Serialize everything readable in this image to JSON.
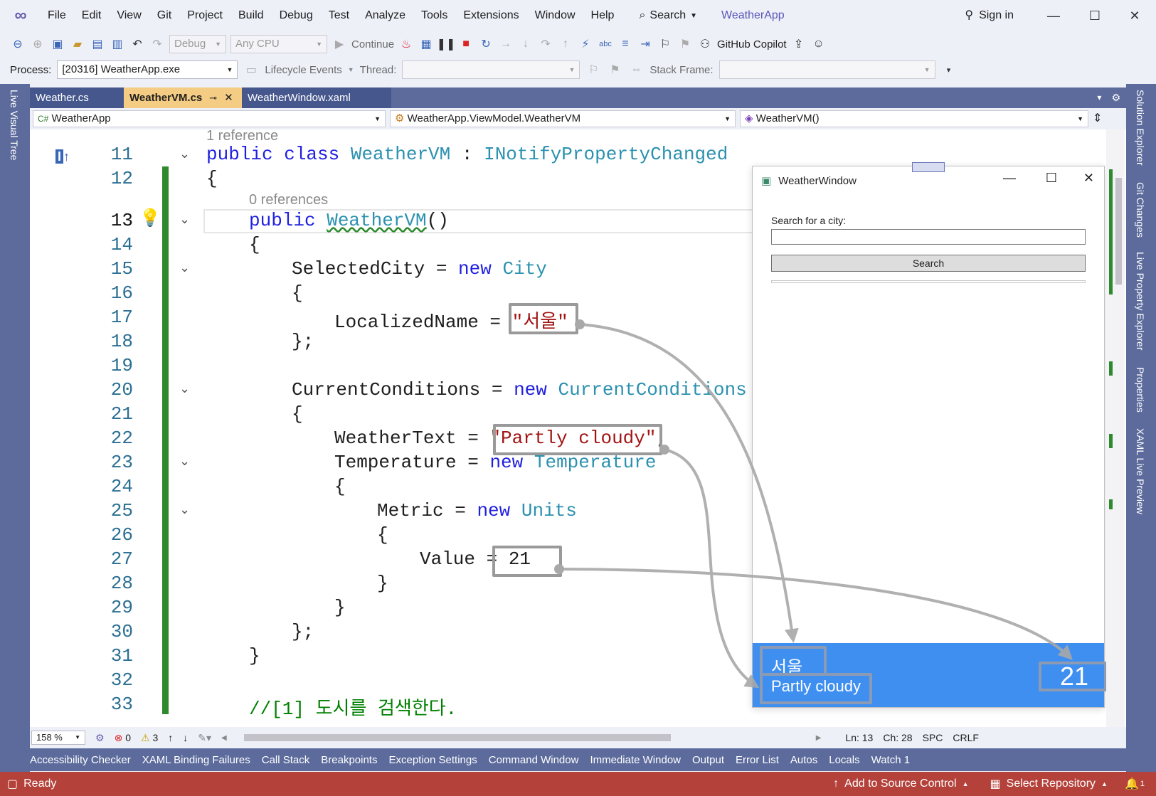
{
  "menubar": {
    "items": [
      "File",
      "Edit",
      "View",
      "Git",
      "Project",
      "Build",
      "Debug",
      "Test",
      "Analyze",
      "Tools",
      "Extensions",
      "Window",
      "Help"
    ],
    "search_label": "Search",
    "app_name": "WeatherApp",
    "sign_in": "Sign in"
  },
  "toolbar1": {
    "config": "Debug",
    "platform": "Any CPU",
    "continue_label": "Continue",
    "copilot_label": "GitHub Copilot"
  },
  "toolbar2": {
    "process_label": "Process:",
    "process_value": "[20316] WeatherApp.exe",
    "lifecycle_label": "Lifecycle Events",
    "thread_label": "Thread:",
    "stackframe_label": "Stack Frame:"
  },
  "side_tabs": {
    "left": "Live Visual Tree",
    "right": [
      "Solution Explorer",
      "Git Changes",
      "Live Property Explorer",
      "Properties",
      "XAML Live Preview"
    ]
  },
  "doc_tabs": [
    {
      "label": "Weather.cs",
      "active": false
    },
    {
      "label": "WeatherVM.cs",
      "active": true
    },
    {
      "label": "WeatherWindow.xaml",
      "active": false
    }
  ],
  "navbar": {
    "project": "WeatherApp",
    "type": "WeatherApp.ViewModel.WeatherVM",
    "member": "WeatherVM()"
  },
  "editor": {
    "ref_hint_class": "1 reference",
    "ref_hint_ctor": "0 references",
    "line_numbers": [
      "11",
      "12",
      "13",
      "14",
      "15",
      "16",
      "17",
      "18",
      "19",
      "20",
      "21",
      "22",
      "23",
      "24",
      "25",
      "26",
      "27",
      "28",
      "29",
      "30",
      "31",
      "32",
      "33"
    ]
  },
  "code": {
    "l11": {
      "kw1": "public class ",
      "ty1": "WeatherVM",
      "p1": " : ",
      "ty2": "INotifyPropertyChanged"
    },
    "l12": "{",
    "l13": {
      "kw": "public ",
      "ty": "WeatherVM",
      "p": "()"
    },
    "l14": "{",
    "l15": {
      "p": "SelectedCity = ",
      "kw": "new ",
      "ty": "City"
    },
    "l16": "{",
    "l17": {
      "p": "LocalizedName = ",
      "st": "\"서울\""
    },
    "l18": "};",
    "l20": {
      "p": "CurrentConditions = ",
      "kw": "new ",
      "ty": "CurrentConditions"
    },
    "l21": "{",
    "l22": {
      "p": "WeatherText = ",
      "st": "\"Partly cloudy\"",
      "end": ","
    },
    "l23": {
      "p": "Temperature = ",
      "kw": "new ",
      "ty": "Temperature"
    },
    "l24": "{",
    "l25": {
      "p": "Metric = ",
      "kw": "new ",
      "ty": "Units"
    },
    "l26": "{",
    "l27": {
      "p": "Value = 21"
    },
    "l28": "}",
    "l29": "}",
    "l30": "};",
    "l31": "}",
    "l33": "//[1] 도시를 검색한다."
  },
  "wpf_window": {
    "title": "WeatherWindow",
    "search_label": "Search for a city:",
    "search_value": "",
    "search_button": "Search",
    "city": "서울",
    "weather_text": "Partly cloudy",
    "temperature": "21"
  },
  "statusbar": {
    "zoom": "158 %",
    "errors": "0",
    "warnings": "3",
    "ln": "Ln: 13",
    "ch": "Ch: 28",
    "spc": "SPC",
    "crlf": "CRLF"
  },
  "tool_windows": [
    "Accessibility Checker",
    "XAML Binding Failures",
    "Call Stack",
    "Breakpoints",
    "Exception Settings",
    "Command Window",
    "Immediate Window",
    "Output",
    "Error List",
    "Autos",
    "Locals",
    "Watch 1"
  ],
  "bottom_status": {
    "ready": "Ready",
    "add_source": "Add to Source Control",
    "select_repo": "Select Repository",
    "notifications": "1"
  },
  "colors": {
    "keyword": "#1f1fe0",
    "type": "#2b91af",
    "string": "#a31515",
    "comment": "#008000",
    "status_bar_debug": "#b4413a",
    "wpf_blue": "#3f8ff0"
  }
}
